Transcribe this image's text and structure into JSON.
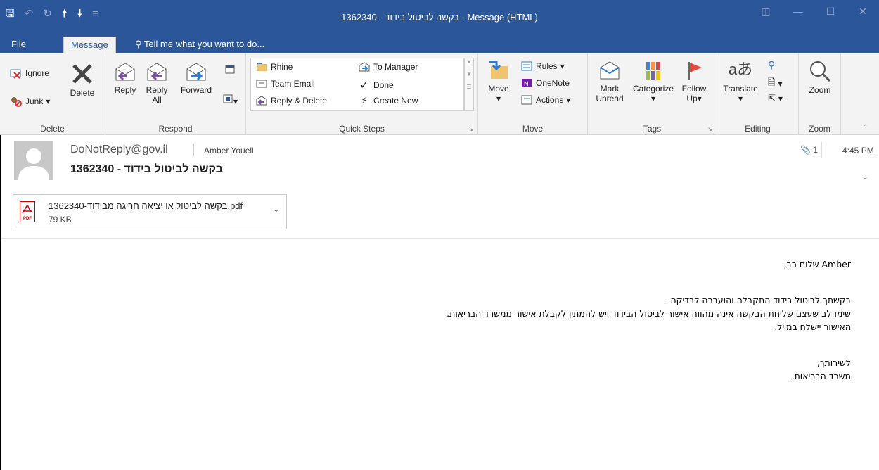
{
  "window": {
    "title": "1362340  - בקשה לביטול בידוד - Message (HTML)"
  },
  "tabs": {
    "file": "File",
    "message": "Message",
    "tell_me": "Tell me what you want to do..."
  },
  "ribbon": {
    "delete_group": {
      "label": "Delete",
      "ignore": "Ignore",
      "junk": "Junk",
      "delete": "Delete"
    },
    "respond_group": {
      "label": "Respond",
      "reply": "Reply",
      "reply_all_1": "Reply",
      "reply_all_2": "All",
      "forward": "Forward"
    },
    "quick_steps": {
      "label": "Quick Steps",
      "items": [
        "Rhine",
        "Team Email",
        "Reply & Delete",
        "To Manager",
        "Done",
        "Create New"
      ]
    },
    "move_group": {
      "label": "Move",
      "move": "Move",
      "rules": "Rules",
      "onenote": "OneNote",
      "actions": "Actions"
    },
    "tags_group": {
      "label": "Tags",
      "mark_1": "Mark",
      "mark_2": "Unread",
      "categorize": "Categorize",
      "follow_1": "Follow",
      "follow_2": "Up"
    },
    "editing_group": {
      "label": "Editing",
      "translate": "Translate"
    },
    "zoom_group": {
      "label": "Zoom",
      "zoom": "Zoom"
    }
  },
  "message": {
    "from": "DoNotReply@gov.il",
    "to": "Amber Youell",
    "subject": "1362340  - בקשה לביטול בידוד",
    "attachment_count": "1",
    "time": "4:45 PM",
    "attachment": {
      "name": "1362340-בקשה לביטול או יציאה חריגה מבידוד.pdf",
      "size": "79 KB",
      "icon_text": "PDF"
    },
    "body": {
      "greeting": "Amber שלום רב,",
      "line1": "בקשתך לביטול בידוד התקבלה והועברה לבדיקה.",
      "line2": "שימו לב שעצם שליחת הבקשה אינה מהווה אישור לביטול הבידוד ויש להמתין לקבלת אישור ממשרד הבריאות.",
      "line3": "האישור יישלח במייל.",
      "closing": "לשירותך,",
      "signature": "משרד הבריאות."
    }
  },
  "colors": {
    "accent": "#2b579a",
    "ribbon_bg": "#f3f3f3",
    "reply_purple": "#7b4fa0",
    "flag_red": "#e74c3c"
  }
}
